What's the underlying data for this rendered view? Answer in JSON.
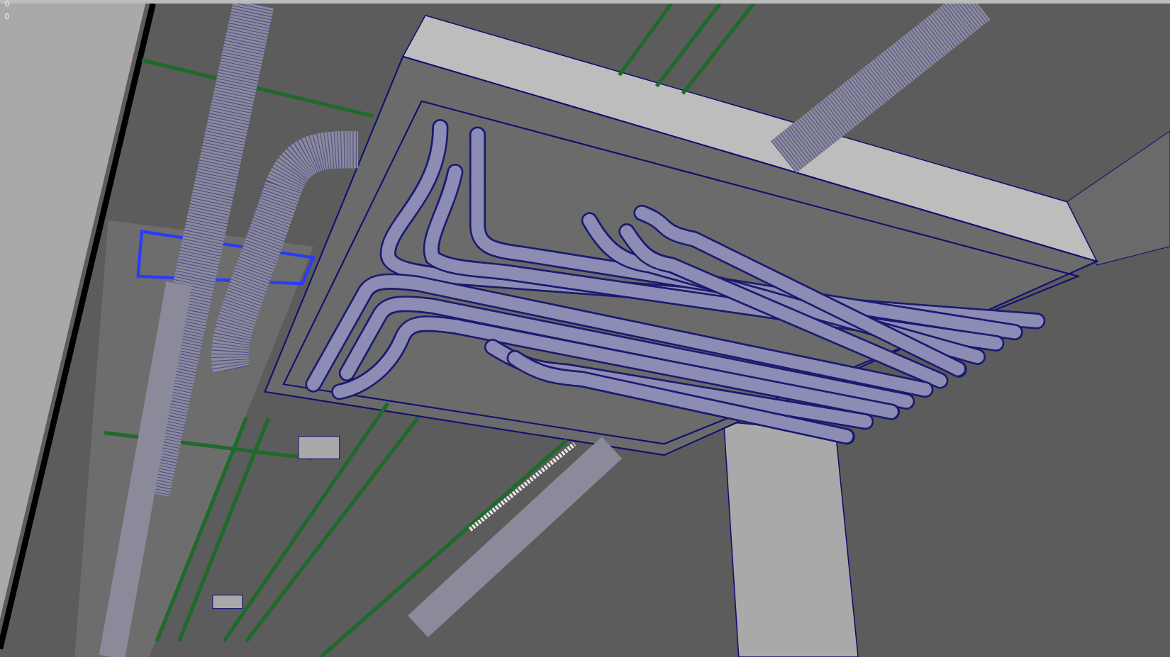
{
  "viewport": {
    "hud_lines": [
      "0",
      "0"
    ]
  }
}
